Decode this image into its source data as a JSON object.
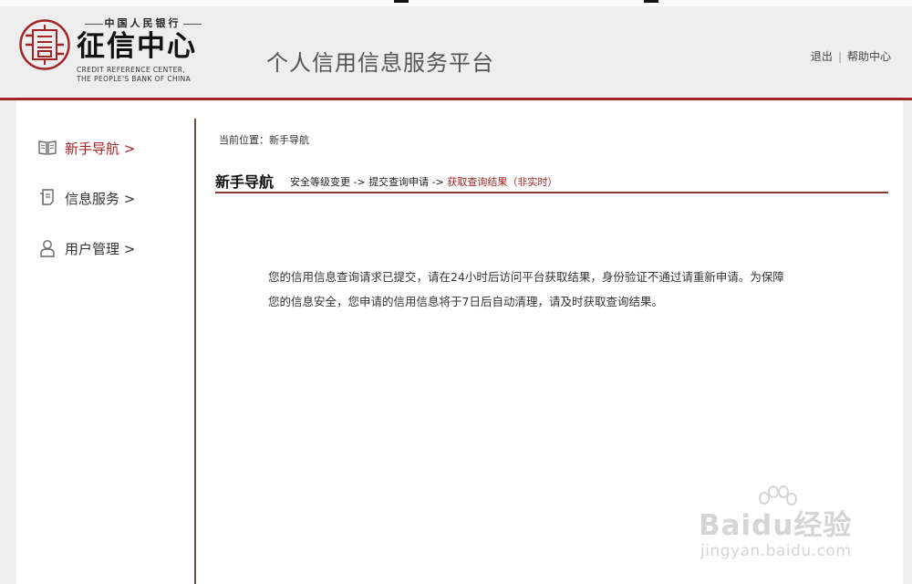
{
  "header": {
    "logo": {
      "top_text": "中国人民银行",
      "main_text": "征信中心",
      "en_line1": "CREDIT REFERENCE  CENTER,",
      "en_line2": "THE PEOPLE'S BANK OF CHINA"
    },
    "platform_title": "个人信用信息服务平台",
    "links": [
      {
        "label": "退出",
        "icon": null
      },
      {
        "label": "帮助中心",
        "icon": null
      }
    ],
    "separator": "|"
  },
  "sidebar": {
    "items": [
      {
        "label": "新手导航 >",
        "icon": "book-icon",
        "active": true
      },
      {
        "label": "信息服务 >",
        "icon": "document-icon",
        "active": false
      },
      {
        "label": "用户管理 >",
        "icon": "user-icon",
        "active": false
      }
    ]
  },
  "main": {
    "breadcrumb": "当前位置：新手导航",
    "section_title": "新手导航",
    "steps": {
      "step1": "安全等级变更 ->",
      "step2": "提交查询申请 ->",
      "step3": "获取查询结果（非实时）"
    },
    "message_line1": "您的信用信息查询请求已提交，请在24小时后访问平台获取结果，身份验证不通过请重新申请。为保障",
    "message_line2": "您的信息安全，您申请的信用信息将于7日后自动清理，请及时获取查询结果。"
  },
  "watermark": {
    "brand": "Baidu经验",
    "url": "jingyan.baidu.com"
  },
  "colors": {
    "accent": "#a42424",
    "header_bg": "#eeeeee",
    "content_bg": "#ffffff",
    "divider": "#6b5040"
  }
}
